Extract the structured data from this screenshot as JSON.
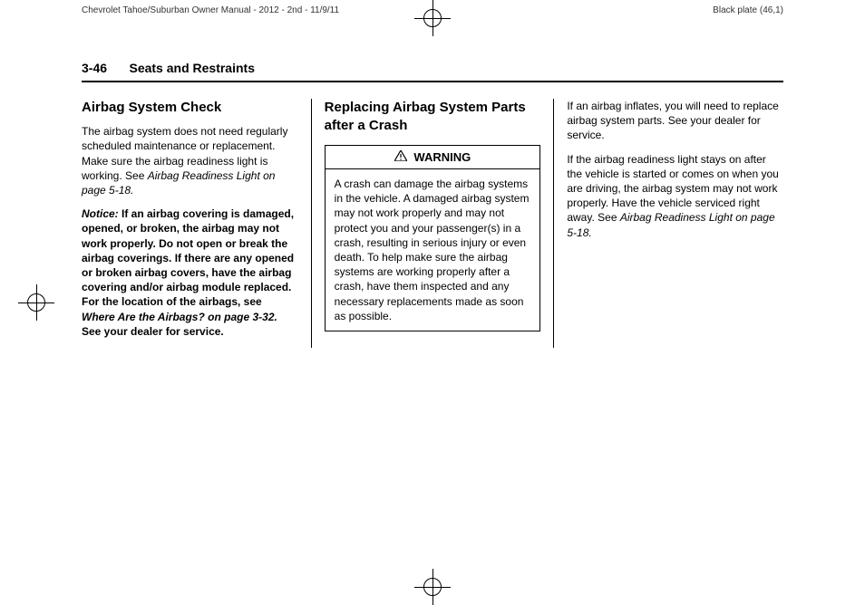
{
  "printHeader": {
    "left": "Chevrolet Tahoe/Suburban Owner Manual - 2012 - 2nd - 11/9/11",
    "right": "Black plate (46,1)"
  },
  "pageHeader": {
    "pageNumber": "3-46",
    "sectionTitle": "Seats and Restraints"
  },
  "col1": {
    "heading": "Airbag System Check",
    "p1_part1": "The airbag system does not need regularly scheduled maintenance or replacement. Make sure the airbag readiness light is working. See ",
    "p1_ref": "Airbag Readiness Light on page 5-18.",
    "noticeLabel": "Notice:",
    "noticeText_part1": " If an airbag covering is damaged, opened, or broken, the airbag may not work properly. Do not open or break the airbag coverings. If there are any opened or broken airbag covers, have the airbag covering and/or airbag module replaced. For the location of the airbags, see ",
    "noticeRef": "Where Are the Airbags? on page 3-32.",
    "noticeText_part2": " See your dealer for service."
  },
  "col2": {
    "heading": "Replacing Airbag System Parts after a Crash",
    "warningLabel": "WARNING",
    "warningBody": "A crash can damage the airbag systems in the vehicle. A damaged airbag system may not work properly and may not protect you and your passenger(s) in a crash, resulting in serious injury or even death. To help make sure the airbag systems are working properly after a crash, have them inspected and any necessary replacements made as soon as possible."
  },
  "col3": {
    "p1": "If an airbag inflates, you will need to replace airbag system parts. See your dealer for service.",
    "p2_part1": "If the airbag readiness light stays on after the vehicle is started or comes on when you are driving, the airbag system may not work properly. Have the vehicle serviced right away. See ",
    "p2_ref": "Airbag Readiness Light on page 5-18."
  }
}
